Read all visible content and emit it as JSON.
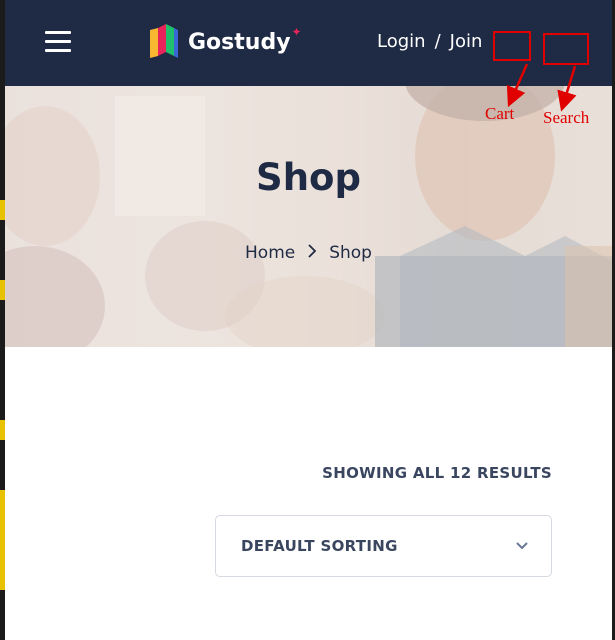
{
  "header": {
    "logo_text": "Gostudy",
    "login_label": "Login",
    "separator": "/",
    "join_label": "Join",
    "background_color": "#1f2a44"
  },
  "annotations": {
    "cart_label": "Cart",
    "search_label": "Search",
    "color": "#e00000"
  },
  "hero": {
    "title": "Shop",
    "breadcrumb": {
      "home": "Home",
      "current": "Shop"
    }
  },
  "shop": {
    "results_text": "SHOWING ALL 12 RESULTS",
    "sorting_value": "DEFAULT SORTING"
  },
  "icons": {
    "menu": "hamburger-menu-icon",
    "logo": "gostudy-logo-icon",
    "breadcrumb_separator": "chevron-right-icon",
    "sorting": "chevron-down-icon"
  }
}
